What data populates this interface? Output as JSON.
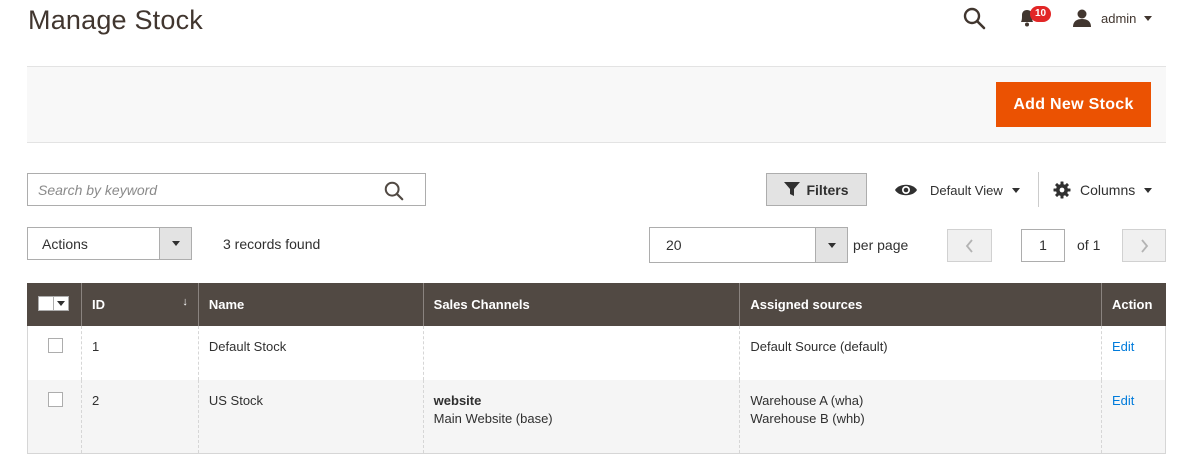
{
  "header": {
    "title": "Manage Stock",
    "notifications_count": "10",
    "user_label": "admin"
  },
  "action_bar": {
    "add_button_label": "Add New Stock"
  },
  "toolbar": {
    "search_placeholder": "Search by keyword",
    "filters_label": "Filters",
    "view_label": "Default View",
    "columns_label": "Columns",
    "actions_label": "Actions",
    "records_found": "3 records found",
    "per_page_value": "20",
    "per_page_label": "per page",
    "current_page": "1",
    "total_pages_label": "of 1"
  },
  "grid": {
    "columns": [
      "ID",
      "Name",
      "Sales Channels",
      "Assigned sources",
      "Action"
    ],
    "rows": [
      {
        "id": "1",
        "name": "Default Stock",
        "channel_type": "",
        "channel_name": "",
        "sources": [
          "Default Source (default)",
          ""
        ],
        "action": "Edit"
      },
      {
        "id": "2",
        "name": "US Stock",
        "channel_type": "website",
        "channel_name": "Main Website (base)",
        "sources": [
          "Warehouse A (wha)",
          "Warehouse B (whb)"
        ],
        "action": "Edit"
      }
    ]
  },
  "colors": {
    "accent": "#eb5202",
    "grid_header": "#514943",
    "link": "#007bdb",
    "badge": "#e22626"
  }
}
